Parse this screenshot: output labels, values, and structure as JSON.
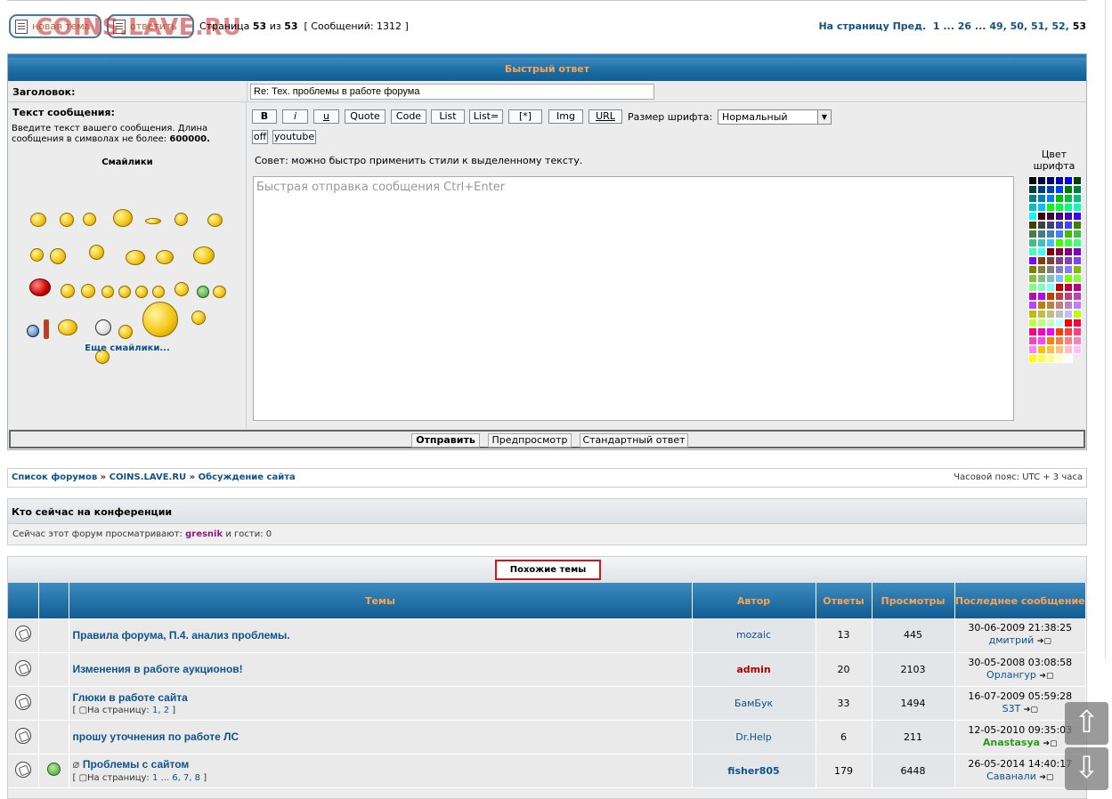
{
  "topbar": {
    "new_topic_label": "новая тема",
    "reply_label": "ответить",
    "watermark": "COINS.LAVE.RU",
    "page_prefix": "Страница",
    "page_current": "53",
    "page_of": "из",
    "page_total": "53",
    "messages": "[ Сообщений: 1312 ]",
    "pagination": {
      "label": "На страницу",
      "prev": "Пред.",
      "pages": [
        "1",
        "...",
        "26",
        "...",
        "49,",
        "50,",
        "51,",
        "52,",
        "53"
      ]
    }
  },
  "quick_reply": {
    "header": "Быстрый ответ",
    "title_label": "Заголовок:",
    "title_value": "Re: Тех. проблемы в работе форума",
    "message_label": "Текст сообщения:",
    "message_hint": "Введите текст вашего сообщения. Длина сообщения в символах не более:",
    "message_limit": "600000.",
    "smilies_label": "Смайлики",
    "more_smilies": "Еще смайлики...",
    "toolbar": [
      "B",
      "i",
      "u",
      "Quote",
      "Code",
      "List",
      "List=",
      "[*]",
      "Img",
      "URL"
    ],
    "font_size_label": "Размер шрифта:",
    "font_size_value": "Нормальный",
    "toolbar2": [
      "off",
      "youtube"
    ],
    "tip": "Совет: можно быстро применить стили к выделенному тексту.",
    "textarea_placeholder": "Быстрая отправка сообщения Ctrl+Enter",
    "color_label": "Цвет шрифта",
    "submit": "Отправить",
    "preview": "Предпросмотр",
    "standard": "Стандартный ответ"
  },
  "breadcrumbs": {
    "items": [
      "Список форумов",
      "COINS.LAVE.RU",
      "Обсуждение сайта"
    ],
    "separator": "»",
    "timezone": "Часовой пояс: UTC + 3 часа"
  },
  "online": {
    "title": "Кто сейчас на конференции",
    "text_before": "Сейчас этот форум просматривают:",
    "user": "gresnik",
    "text_after": "и гости: 0"
  },
  "similar": {
    "title": "Похожие темы",
    "columns": [
      "Темы",
      "Автор",
      "Ответы",
      "Просмотры",
      "Последнее сообщение"
    ],
    "pages_label": "На страницу:",
    "rows": [
      {
        "title": "Правила форума, П.4. анализ проблемы.",
        "pages": "",
        "author": "mozaic",
        "replies": "13",
        "views": "445",
        "last_date": "30-06-2009 21:38:25",
        "last_user": "дмитрий"
      },
      {
        "title": "Изменения в работе аукционов!",
        "pages": "",
        "author": "admin",
        "replies": "20",
        "views": "2103",
        "last_date": "30-05-2008 03:08:58",
        "last_user": "Орлангур"
      },
      {
        "title": "Глюки в работе сайта",
        "pages": "1, 2",
        "author": "БамБук",
        "replies": "33",
        "views": "1494",
        "last_date": "16-07-2009 05:59:28",
        "last_user": "S3T"
      },
      {
        "title": "прошу уточнения по работе ЛС",
        "pages": "",
        "author": "Dr.Help",
        "replies": "6",
        "views": "211",
        "last_date": "12-05-2010 09:35:03",
        "last_user": "Anastasya"
      },
      {
        "title": "Проблемы с сайтом",
        "pages": "1 ... 6, 7, 8",
        "author": "fisher805",
        "replies": "179",
        "views": "6448",
        "last_date": "26-05-2014 14:40:17",
        "last_user": "Саванали"
      }
    ]
  },
  "colors": {
    "header_blue": "#105d93",
    "header_text": "#ffa34f",
    "link": "#105289",
    "admin": "#aa0000",
    "online_user": "#8a1a7a",
    "green_user": "#2a9a1a"
  },
  "icons": [
    "new-topic-icon",
    "reply-icon",
    "topic-read-icon",
    "grin-smiley-icon",
    "attachment-icon",
    "goto-last-post-icon",
    "scroll-up-icon",
    "scroll-down-icon"
  ]
}
